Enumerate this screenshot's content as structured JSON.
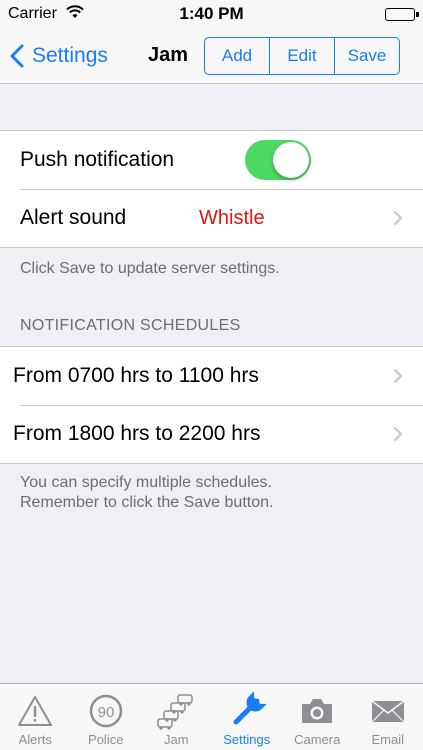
{
  "status_bar": {
    "carrier": "Carrier",
    "time": "1:40 PM"
  },
  "nav": {
    "back_label": "Settings",
    "title": "Jam",
    "segments": [
      "Add",
      "Edit",
      "Save"
    ]
  },
  "settings": {
    "push_label": "Push notification",
    "push_enabled": true,
    "alert_label": "Alert sound",
    "alert_value": "Whistle",
    "footer": "Click Save to update server settings."
  },
  "schedules": {
    "header": "NOTIFICATION SCHEDULES",
    "items": [
      "From 0700 hrs to 1100 hrs",
      "From 1800 hrs to 2200 hrs"
    ],
    "footer_line1": "You can specify multiple schedules.",
    "footer_line2": "Remember to click the Save button."
  },
  "tabs": [
    {
      "label": "Alerts",
      "icon": "warning-triangle-icon"
    },
    {
      "label": "Police",
      "icon": "speed-limit-90-icon",
      "icon_text": "90"
    },
    {
      "label": "Jam",
      "icon": "traffic-jam-icon"
    },
    {
      "label": "Settings",
      "icon": "wrench-icon",
      "active": true
    },
    {
      "label": "Camera",
      "icon": "camera-icon"
    },
    {
      "label": "Email",
      "icon": "envelope-icon"
    }
  ],
  "colors": {
    "accent": "#1a7cf5",
    "toggle_on": "#4cd964",
    "alert_value": "#e0160f",
    "background": "#efeff4"
  }
}
